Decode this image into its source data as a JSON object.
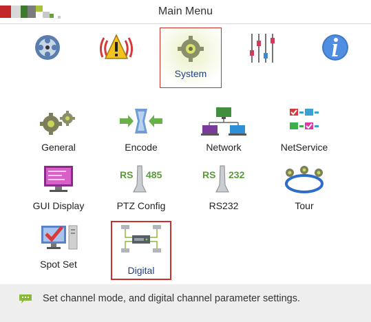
{
  "window": {
    "title": "Main Menu"
  },
  "header_tabs": [
    {
      "label": "Record",
      "icon": "reel-icon",
      "selected": false
    },
    {
      "label": "Alarm",
      "icon": "alarm-icon",
      "selected": false
    },
    {
      "label": "System",
      "icon": "gear-icon",
      "selected": true
    },
    {
      "label": "Advanced",
      "icon": "sliders-icon",
      "selected": false
    },
    {
      "label": "Info",
      "icon": "info-icon",
      "selected": false
    }
  ],
  "items": [
    {
      "label": "General",
      "icon": "gears-icon"
    },
    {
      "label": "Encode",
      "icon": "encode-icon"
    },
    {
      "label": "Network",
      "icon": "network-icon"
    },
    {
      "label": "NetService",
      "icon": "netservice-icon"
    },
    {
      "label": "GUI Display",
      "icon": "gui-display-icon"
    },
    {
      "label": "PTZ Config",
      "icon": "rs485-icon",
      "icon_text": "RS",
      "icon_number": "485"
    },
    {
      "label": "RS232",
      "icon": "rs232-icon",
      "icon_text": "RS",
      "icon_number": "232"
    },
    {
      "label": "Tour",
      "icon": "tour-icon"
    },
    {
      "label": "Spot Set",
      "icon": "spot-set-icon"
    },
    {
      "label": "Digital",
      "icon": "digital-icon",
      "selected": true
    }
  ],
  "status": {
    "message": "Set channel mode, and digital channel parameter settings.",
    "icon": "speech-bubble-icon"
  },
  "colors": {
    "selected_border": "#c9302c",
    "selected_text": "#1e3f8c",
    "status_bg": "#eeeeee"
  }
}
